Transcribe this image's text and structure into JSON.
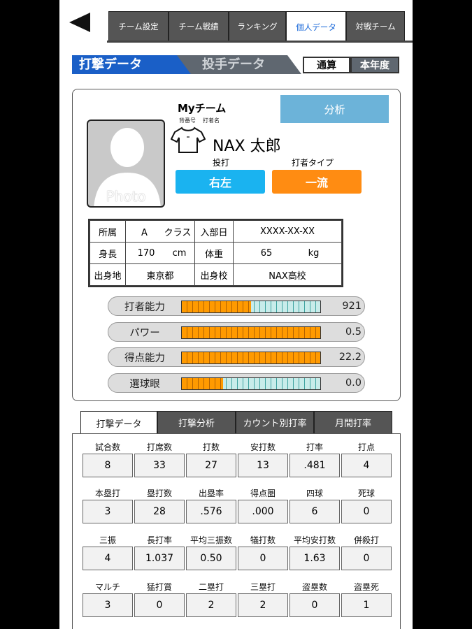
{
  "header": {
    "tabs": [
      {
        "label": "チーム設定",
        "active": false
      },
      {
        "label": "チーム戦績",
        "active": false
      },
      {
        "label": "ランキング",
        "active": false
      },
      {
        "label": "個人データ",
        "active": true
      },
      {
        "label": "対戦チーム",
        "active": false
      }
    ]
  },
  "subtabs": {
    "batting": "打撃データ",
    "pitching": "投手データ",
    "period_total": "通算",
    "period_year": "本年度"
  },
  "profile": {
    "team": "Myチーム",
    "number_label": "背番号",
    "batter_name_label": "打者名",
    "name": "NAX 太郎",
    "analyze_button": "分析",
    "throw_bat_label": "投打",
    "throw_bat": "右左",
    "batter_type_label": "打者タイプ",
    "batter_type": "一流",
    "photo_label": "Photo",
    "info": {
      "affiliation_label": "所属",
      "affiliation": "A",
      "class_label": "クラス",
      "join_date_label": "入部日",
      "join_date": "XXXX-XX-XX",
      "height_label": "身長",
      "height": "170",
      "height_unit": "cm",
      "weight_label": "体重",
      "weight": "65",
      "weight_unit": "kg",
      "birthplace_label": "出身地",
      "birthplace": "東京都",
      "school_label": "出身校",
      "school": "NAX高校"
    },
    "abilities": [
      {
        "label": "打者能力",
        "value": "921",
        "level": 0.5
      },
      {
        "label": "パワー",
        "value": "0.5",
        "level": 1.0
      },
      {
        "label": "得点能力",
        "value": "22.2",
        "level": 1.0
      },
      {
        "label": "選球眼",
        "value": "0.0",
        "level": 0.3
      }
    ]
  },
  "stats_tabs": [
    {
      "label": "打撃データ",
      "active": true
    },
    {
      "label": "打撃分析",
      "active": false
    },
    {
      "label": "カウント別打率",
      "active": false
    },
    {
      "label": "月間打率",
      "active": false
    }
  ],
  "stats": [
    {
      "headers": [
        "試合数",
        "打席数",
        "打数",
        "安打数",
        "打率",
        "打点"
      ],
      "values": [
        "8",
        "33",
        "27",
        "13",
        ".481",
        "4"
      ]
    },
    {
      "headers": [
        "本塁打",
        "塁打数",
        "出塁率",
        "得点圏",
        "四球",
        "死球"
      ],
      "values": [
        "3",
        "28",
        ".576",
        ".000",
        "6",
        "0"
      ]
    },
    {
      "headers": [
        "三振",
        "長打率",
        "平均三振数",
        "犠打数",
        "平均安打数",
        "併殺打"
      ],
      "values": [
        "4",
        "1.037",
        "0.50",
        "0",
        "1.63",
        "0"
      ]
    },
    {
      "headers": [
        "マルチ",
        "猛打賞",
        "二塁打",
        "三塁打",
        "盗塁数",
        "盗塁死"
      ],
      "values": [
        "3",
        "0",
        "2",
        "2",
        "0",
        "1"
      ]
    }
  ],
  "colors": {
    "accent_blue": "#1a5fc7",
    "analyze_bg": "#6cb3d9",
    "throw_bat_bg": "#1ab3f0",
    "batter_type_bg": "#ff8c12",
    "meter_fill": "#ff9a00"
  }
}
